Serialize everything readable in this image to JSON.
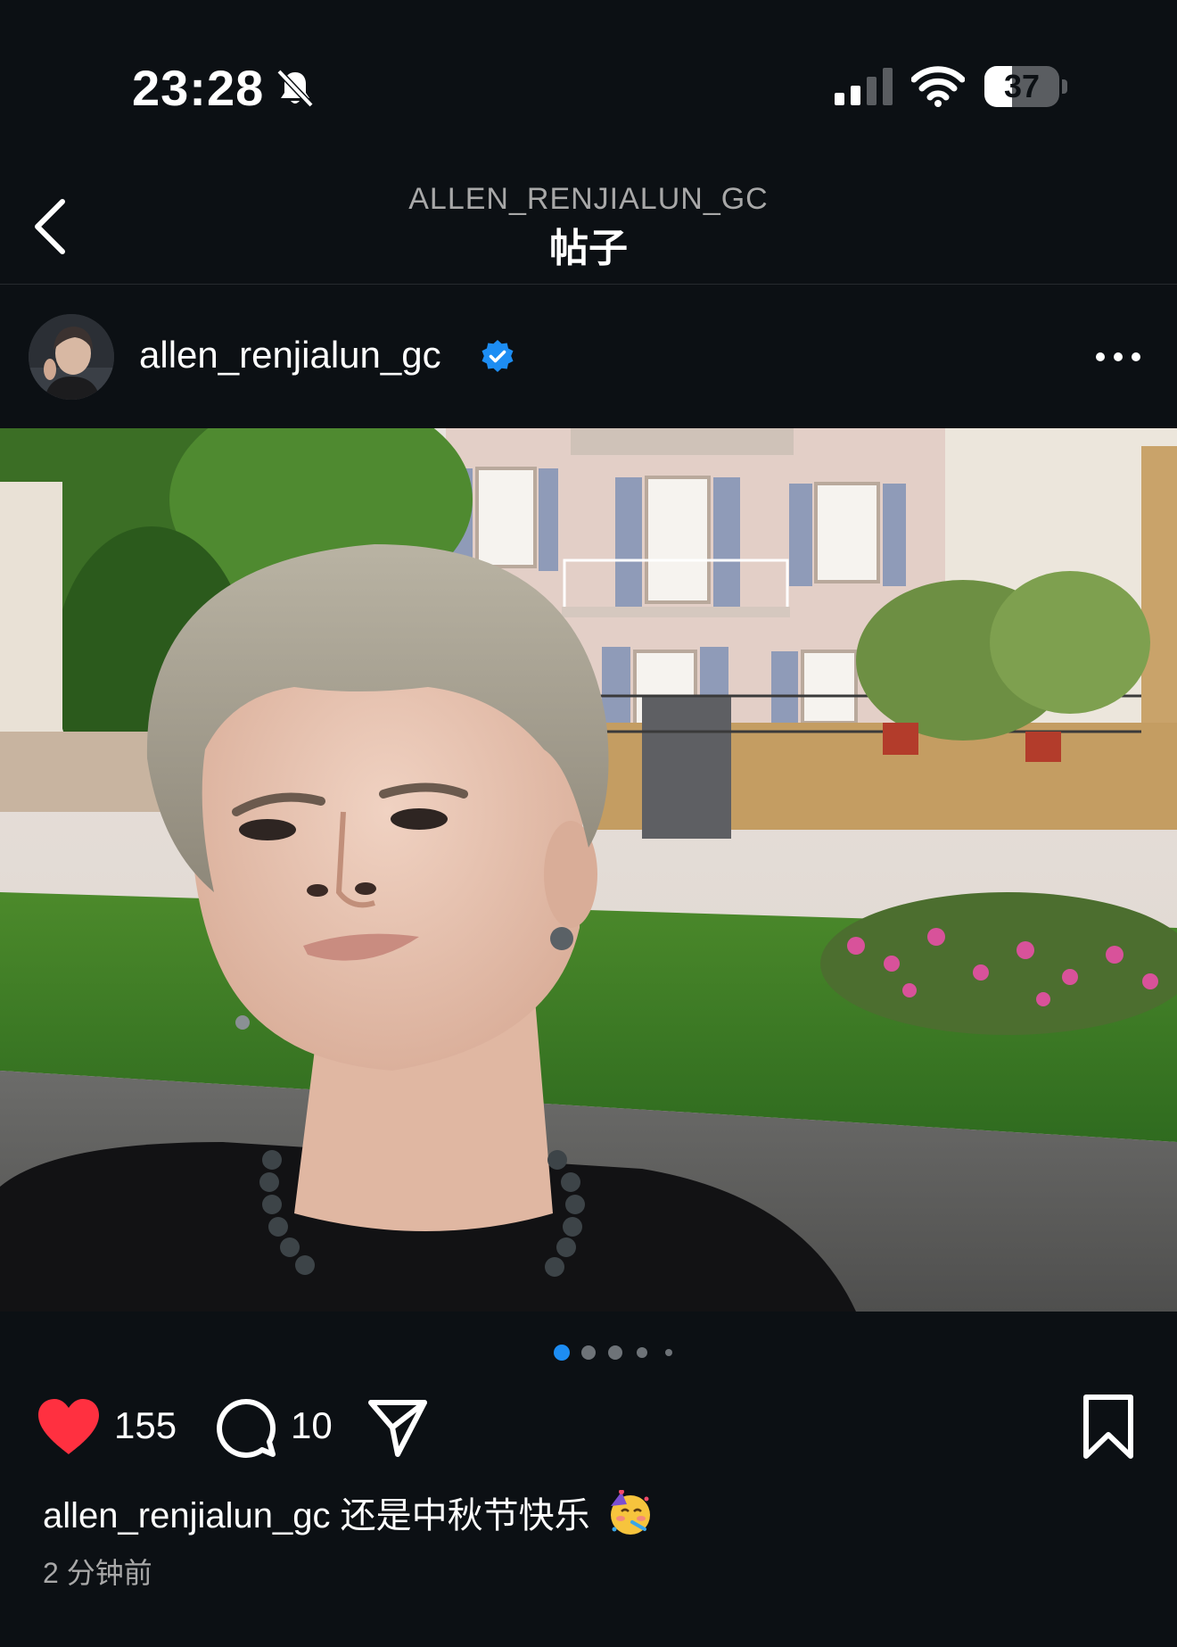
{
  "status_bar": {
    "time": "23:28",
    "battery_level": "37",
    "battery_fraction": 0.37,
    "icons": [
      "bell-slash-icon",
      "cellular-signal-icon",
      "wifi-icon",
      "battery-icon"
    ]
  },
  "header": {
    "subtitle": "ALLEN_RENJIALUN_GC",
    "title": "帖子",
    "back_icon": "chevron-left-icon"
  },
  "post": {
    "username": "allen_renjialun_gc",
    "verified": true,
    "more_icon": "ellipsis-icon",
    "carousel": {
      "total": 5,
      "active_index": 0
    },
    "likes": "155",
    "comments": "10",
    "liked": true,
    "caption": {
      "username": "allen_renjialun_gc",
      "text": "还是中秋节快乐",
      "emoji": "partying-face-icon"
    },
    "timestamp": "2 分钟前"
  },
  "colors": {
    "background": "#0c1014",
    "accent_blue": "#1d8df3",
    "like_red": "#ff3040",
    "secondary_text": "#a8a8a8"
  }
}
